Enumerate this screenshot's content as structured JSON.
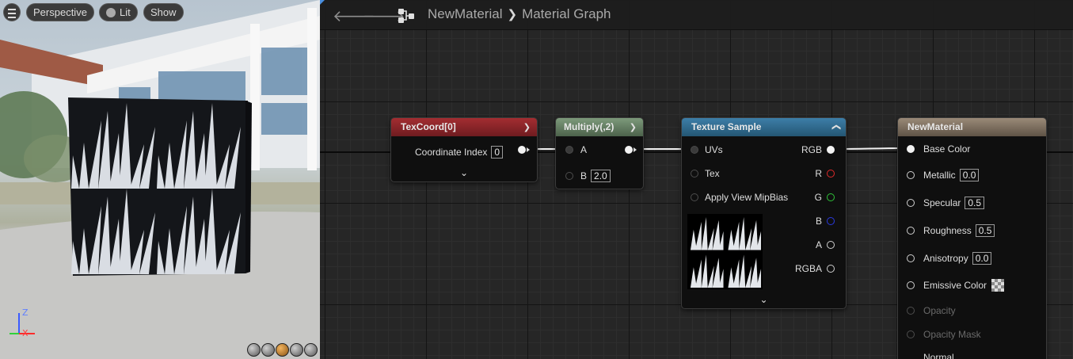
{
  "viewport": {
    "menu_icon": "hamburger-icon",
    "perspective_label": "Perspective",
    "lit_label": "Lit",
    "show_label": "Show",
    "axis": {
      "z_label": "Z",
      "x_label": "X"
    },
    "view_mode_icons": [
      "sphere-icon",
      "cylinder-icon",
      "plane-icon",
      "cube-icon",
      "teapot-icon"
    ],
    "active_view_mode": 2
  },
  "graph": {
    "nav": {
      "back_icon": "arrow-left-icon",
      "forward_icon": "arrow-right-icon",
      "graph_icon": "graph-icon"
    },
    "breadcrumb": {
      "root": "NewMaterial",
      "current": "Material Graph"
    },
    "nodes": {
      "texcoord": {
        "title": "TexCoord[0]",
        "rows": [
          {
            "label": "Coordinate Index",
            "value": "0"
          }
        ]
      },
      "multiply": {
        "title": "Multiply(,2)",
        "inputs": [
          {
            "label": "A"
          },
          {
            "label": "B",
            "value": "2.0"
          }
        ]
      },
      "texture_sample": {
        "title": "Texture Sample",
        "inputs": [
          {
            "label": "UVs"
          },
          {
            "label": "Tex"
          },
          {
            "label": "Apply View MipBias"
          }
        ],
        "outputs": [
          {
            "label": "RGB",
            "color": "#f2f2f2"
          },
          {
            "label": "R",
            "color": "#e02a2a"
          },
          {
            "label": "G",
            "color": "#2fc43a"
          },
          {
            "label": "B",
            "color": "#2a3ae0"
          },
          {
            "label": "A",
            "color": "#d9d9d9"
          },
          {
            "label": "RGBA",
            "color": "#d9d9d9"
          }
        ]
      },
      "material": {
        "title": "NewMaterial",
        "inputs": [
          {
            "label": "Base Color",
            "value": ""
          },
          {
            "label": "Metallic",
            "value": "0.0"
          },
          {
            "label": "Specular",
            "value": "0.5"
          },
          {
            "label": "Roughness",
            "value": "0.5"
          },
          {
            "label": "Anisotropy",
            "value": "0.0"
          },
          {
            "label": "Emissive Color",
            "value": ""
          },
          {
            "label": "Opacity",
            "value": ""
          },
          {
            "label": "Opacity Mask",
            "value": ""
          },
          {
            "label": "Normal",
            "value": ""
          }
        ]
      }
    }
  }
}
